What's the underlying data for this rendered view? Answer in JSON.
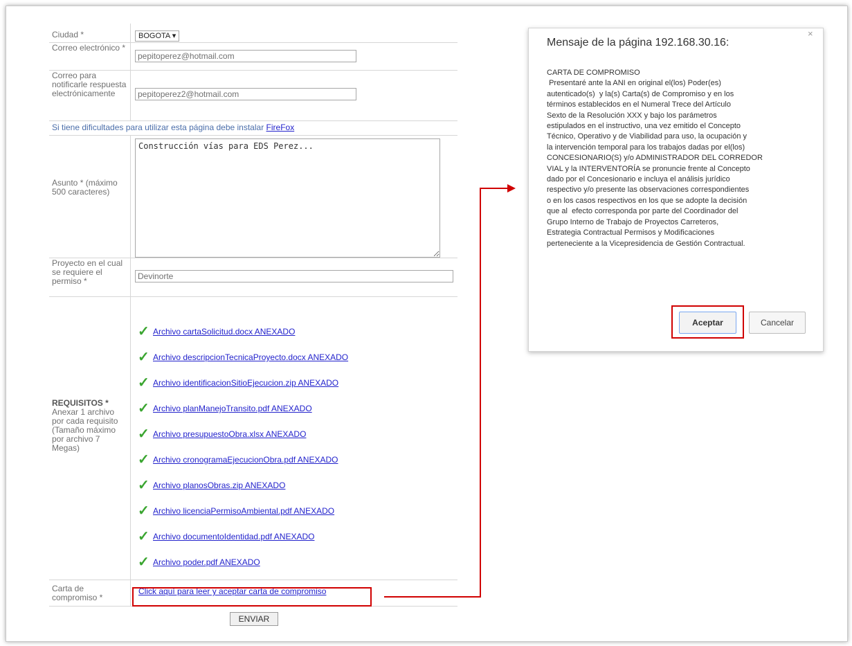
{
  "form": {
    "ciudad_label": "Ciudad *",
    "ciudad_value": "BOGOTA",
    "correo_label": "Correo electrónico *",
    "correo_value": "pepitoperez@hotmail.com",
    "correo_notif_label": "Correo para notificarle respuesta electrónicamente",
    "correo_notif_value": "pepitoperez2@hotmail.com",
    "notice_text": "Si tiene dificultades para utilizar esta página debe instalar ",
    "notice_link": "FireFox",
    "asunto_label": "Asunto * (máximo 500 caracteres)",
    "asunto_value": "Construcción vías para EDS Perez...",
    "proyecto_label": "Proyecto en el cual se requiere el permiso *",
    "proyecto_value": "Devinorte",
    "requisitos_title": "REQUISITOS *",
    "requisitos_desc": "Anexar 1 archivo por cada requisito (Tamaño máximo por archivo 7 Megas)",
    "files": [
      "Archivo cartaSolicitud.docx ANEXADO",
      "Archivo descripcionTecnicaProyecto.docx ANEXADO",
      "Archivo identificacionSitioEjecucion.zip ANEXADO",
      "Archivo planManejoTransito.pdf ANEXADO",
      "Archivo presupuestoObra.xlsx ANEXADO",
      "Archivo cronogramaEjecucionObra.pdf ANEXADO",
      "Archivo planosObras.zip ANEXADO",
      "Archivo licenciaPermisoAmbiental.pdf ANEXADO",
      "Archivo documentoIdentidad.pdf ANEXADO",
      "Archivo poder.pdf ANEXADO"
    ],
    "carta_label": "Carta de compromiso *",
    "carta_link": "Click aquí para leer y aceptar carta de compromiso",
    "submit_label": "ENVIAR"
  },
  "dialog": {
    "title": "Mensaje de la página 192.168.30.16:",
    "close_glyph": "×",
    "body": "CARTA DE COMPROMISO\n Presentaré ante la ANI en original el(los) Poder(es)\nautenticado(s)  y la(s) Carta(s) de Compromiso y en los\ntérminos establecidos en el Numeral Trece del Artículo\nSexto de la Resolución XXX y bajo los parámetros\nestipulados en el instructivo, una vez emitido el Concepto\nTécnico, Operativo y de Viabilidad para uso, la ocupación y\nla intervención temporal para los trabajos dadas por el(los)\nCONCESIONARIO(S) y/o ADMINISTRADOR DEL CORREDOR\nVIAL y la INTERVENTORÍA se pronuncie frente al Concepto\ndado por el Concesionario e incluya el análisis jurídico\nrespectivo y/o presente las observaciones correspondientes\no en los casos respectivos en los que se adopte la decisión\nque al  efecto corresponda por parte del Coordinador del\nGrupo Interno de Trabajo de Proyectos Carreteros,\nEstrategia Contractual Permisos y Modificaciones\nperteneciente a la Vicepresidencia de Gestión Contractual.",
    "ok_label": "Aceptar",
    "cancel_label": "Cancelar"
  },
  "colors": {
    "highlight": "#d00000",
    "link": "#2222cc",
    "check": "#3aa530"
  }
}
